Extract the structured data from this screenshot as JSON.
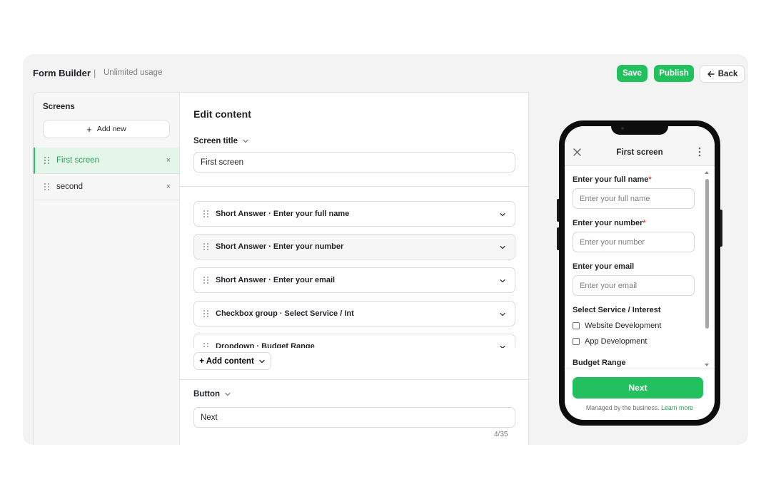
{
  "header": {
    "app_title": "Form Builder",
    "separator": "|",
    "usage": "Unlimited usage",
    "save_label": "Save",
    "publish_label": "Publish",
    "back_label": "Back"
  },
  "colors": {
    "accent": "#22c15e",
    "required": "#e1492f"
  },
  "sidebar": {
    "title": "Screens",
    "add_new_label": "Add new",
    "screens": [
      {
        "label": "First screen",
        "active": true
      },
      {
        "label": "second",
        "active": false
      }
    ],
    "close_glyph": "×"
  },
  "editor": {
    "title": "Edit content",
    "screen_title_label": "Screen title",
    "screen_title_value": "First screen",
    "content_items": [
      "Short Answer · Enter your full name",
      "Short Answer · Enter your number",
      "Short Answer · Enter your email",
      "Checkbox group · Select Service / Int",
      "Dropdown · Budget Range"
    ],
    "add_content_label": "+ Add content",
    "button_label": "Button",
    "button_value": "Next",
    "char_counter": "4/35"
  },
  "preview": {
    "screen_title": "First screen",
    "fields": [
      {
        "label": "Enter your full name",
        "required": true,
        "placeholder": "Enter your full name"
      },
      {
        "label": "Enter your number",
        "required": true,
        "placeholder": "Enter your number"
      },
      {
        "label": "Enter your email",
        "required": false,
        "placeholder": "Enter your email"
      }
    ],
    "required_mark": "*",
    "checkbox_group_label": "Select Service / Interest",
    "checkbox_options": [
      "Website Development",
      "App Development"
    ],
    "dropdown_label": "Budget Range",
    "next_label": "Next",
    "managed_text": "Managed by the business.",
    "learn_more": "Learn more"
  }
}
